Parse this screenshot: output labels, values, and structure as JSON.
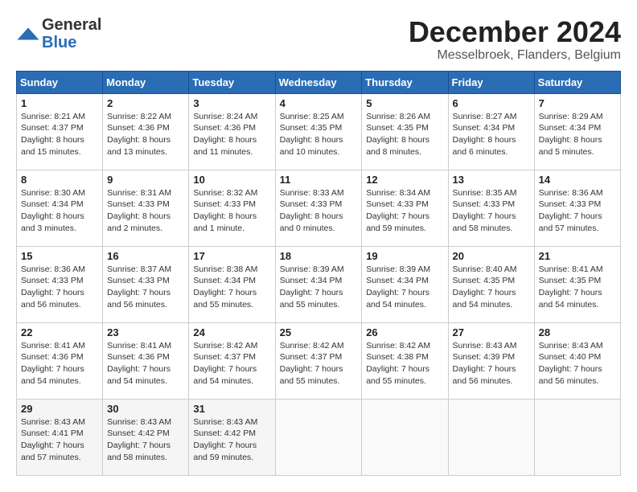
{
  "header": {
    "logo_line1": "General",
    "logo_line2": "Blue",
    "month_year": "December 2024",
    "location": "Messelbroek, Flanders, Belgium"
  },
  "calendar": {
    "days_of_week": [
      "Sunday",
      "Monday",
      "Tuesday",
      "Wednesday",
      "Thursday",
      "Friday",
      "Saturday"
    ],
    "weeks": [
      [
        {
          "day": "1",
          "sunrise": "8:21 AM",
          "sunset": "4:37 PM",
          "daylight": "8 hours and 15 minutes."
        },
        {
          "day": "2",
          "sunrise": "8:22 AM",
          "sunset": "4:36 PM",
          "daylight": "8 hours and 13 minutes."
        },
        {
          "day": "3",
          "sunrise": "8:24 AM",
          "sunset": "4:36 PM",
          "daylight": "8 hours and 11 minutes."
        },
        {
          "day": "4",
          "sunrise": "8:25 AM",
          "sunset": "4:35 PM",
          "daylight": "8 hours and 10 minutes."
        },
        {
          "day": "5",
          "sunrise": "8:26 AM",
          "sunset": "4:35 PM",
          "daylight": "8 hours and 8 minutes."
        },
        {
          "day": "6",
          "sunrise": "8:27 AM",
          "sunset": "4:34 PM",
          "daylight": "8 hours and 6 minutes."
        },
        {
          "day": "7",
          "sunrise": "8:29 AM",
          "sunset": "4:34 PM",
          "daylight": "8 hours and 5 minutes."
        }
      ],
      [
        {
          "day": "8",
          "sunrise": "8:30 AM",
          "sunset": "4:34 PM",
          "daylight": "8 hours and 3 minutes."
        },
        {
          "day": "9",
          "sunrise": "8:31 AM",
          "sunset": "4:33 PM",
          "daylight": "8 hours and 2 minutes."
        },
        {
          "day": "10",
          "sunrise": "8:32 AM",
          "sunset": "4:33 PM",
          "daylight": "8 hours and 1 minute."
        },
        {
          "day": "11",
          "sunrise": "8:33 AM",
          "sunset": "4:33 PM",
          "daylight": "8 hours and 0 minutes."
        },
        {
          "day": "12",
          "sunrise": "8:34 AM",
          "sunset": "4:33 PM",
          "daylight": "7 hours and 59 minutes."
        },
        {
          "day": "13",
          "sunrise": "8:35 AM",
          "sunset": "4:33 PM",
          "daylight": "7 hours and 58 minutes."
        },
        {
          "day": "14",
          "sunrise": "8:36 AM",
          "sunset": "4:33 PM",
          "daylight": "7 hours and 57 minutes."
        }
      ],
      [
        {
          "day": "15",
          "sunrise": "8:36 AM",
          "sunset": "4:33 PM",
          "daylight": "7 hours and 56 minutes."
        },
        {
          "day": "16",
          "sunrise": "8:37 AM",
          "sunset": "4:33 PM",
          "daylight": "7 hours and 56 minutes."
        },
        {
          "day": "17",
          "sunrise": "8:38 AM",
          "sunset": "4:34 PM",
          "daylight": "7 hours and 55 minutes."
        },
        {
          "day": "18",
          "sunrise": "8:39 AM",
          "sunset": "4:34 PM",
          "daylight": "7 hours and 55 minutes."
        },
        {
          "day": "19",
          "sunrise": "8:39 AM",
          "sunset": "4:34 PM",
          "daylight": "7 hours and 54 minutes."
        },
        {
          "day": "20",
          "sunrise": "8:40 AM",
          "sunset": "4:35 PM",
          "daylight": "7 hours and 54 minutes."
        },
        {
          "day": "21",
          "sunrise": "8:41 AM",
          "sunset": "4:35 PM",
          "daylight": "7 hours and 54 minutes."
        }
      ],
      [
        {
          "day": "22",
          "sunrise": "8:41 AM",
          "sunset": "4:36 PM",
          "daylight": "7 hours and 54 minutes."
        },
        {
          "day": "23",
          "sunrise": "8:41 AM",
          "sunset": "4:36 PM",
          "daylight": "7 hours and 54 minutes."
        },
        {
          "day": "24",
          "sunrise": "8:42 AM",
          "sunset": "4:37 PM",
          "daylight": "7 hours and 54 minutes."
        },
        {
          "day": "25",
          "sunrise": "8:42 AM",
          "sunset": "4:37 PM",
          "daylight": "7 hours and 55 minutes."
        },
        {
          "day": "26",
          "sunrise": "8:42 AM",
          "sunset": "4:38 PM",
          "daylight": "7 hours and 55 minutes."
        },
        {
          "day": "27",
          "sunrise": "8:43 AM",
          "sunset": "4:39 PM",
          "daylight": "7 hours and 56 minutes."
        },
        {
          "day": "28",
          "sunrise": "8:43 AM",
          "sunset": "4:40 PM",
          "daylight": "7 hours and 56 minutes."
        }
      ],
      [
        {
          "day": "29",
          "sunrise": "8:43 AM",
          "sunset": "4:41 PM",
          "daylight": "7 hours and 57 minutes."
        },
        {
          "day": "30",
          "sunrise": "8:43 AM",
          "sunset": "4:42 PM",
          "daylight": "7 hours and 58 minutes."
        },
        {
          "day": "31",
          "sunrise": "8:43 AM",
          "sunset": "4:42 PM",
          "daylight": "7 hours and 59 minutes."
        },
        null,
        null,
        null,
        null
      ]
    ]
  }
}
